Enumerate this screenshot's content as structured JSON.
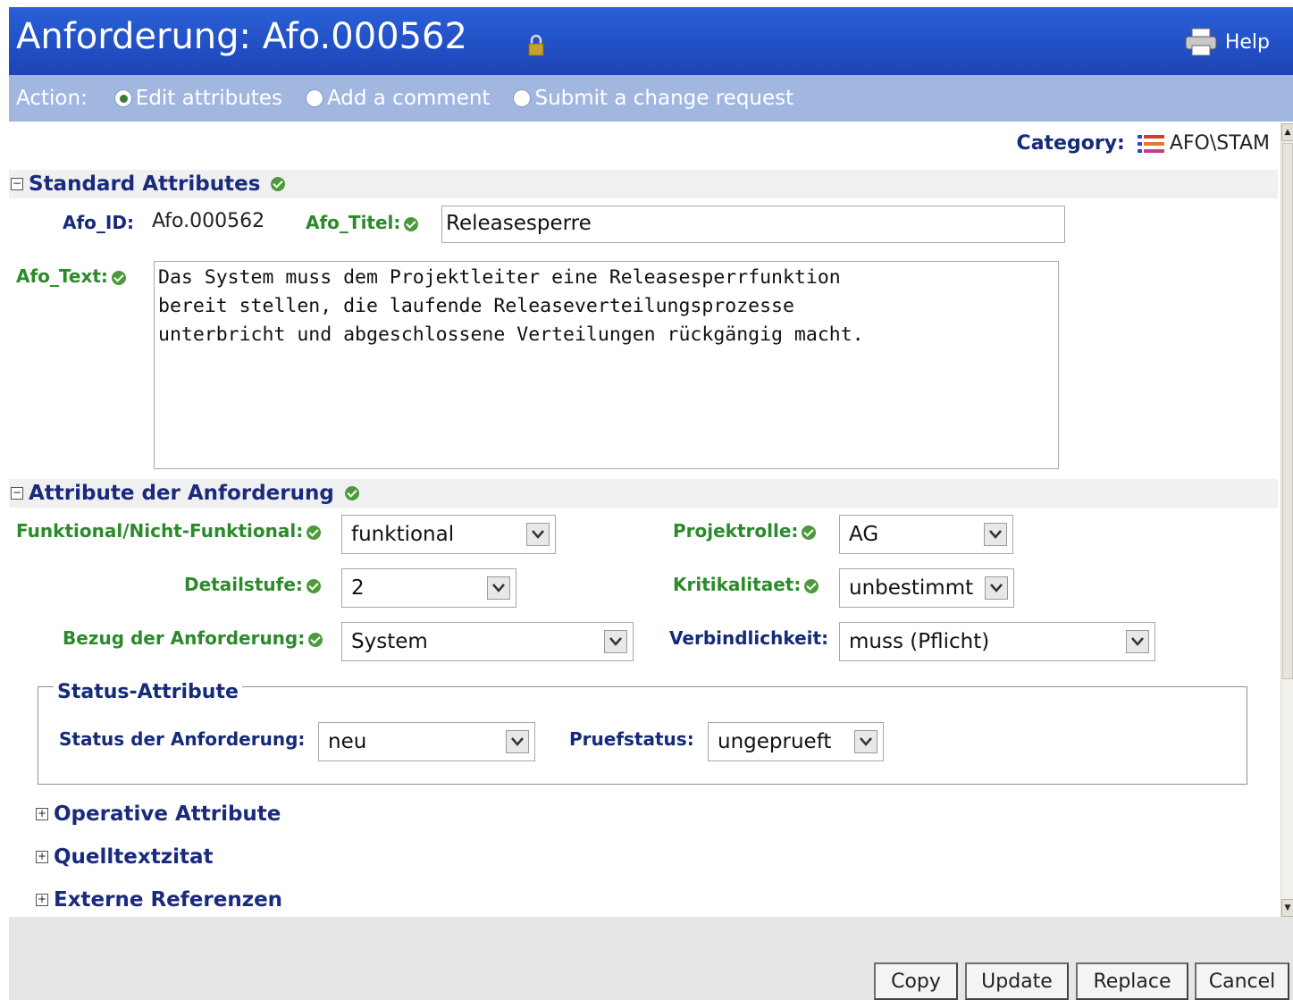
{
  "header": {
    "title": "Anforderung: Afo.000562",
    "help_label": "Help"
  },
  "actionbar": {
    "label": "Action:",
    "options": [
      {
        "label": "Edit attributes",
        "selected": true
      },
      {
        "label": "Add a comment",
        "selected": false
      },
      {
        "label": "Submit a change request",
        "selected": false
      }
    ]
  },
  "category": {
    "label": "Category:",
    "value": "AFO\\STAM"
  },
  "standard": {
    "heading": "Standard Attributes",
    "afo_id_label": "Afo_ID:",
    "afo_id_value": "Afo.000562",
    "afo_titel_label": "Afo_Titel:",
    "afo_titel_value": "Releasesperre",
    "afo_text_label": "Afo_Text:",
    "afo_text_value": "Das System muss dem Projektleiter eine Releasesperrfunktion\nbereit stellen, die laufende Releaseverteilungsprozesse\nunterbricht und abgeschlossene Verteilungen rückgängig macht."
  },
  "anforderung": {
    "heading": "Attribute der Anforderung",
    "funktional_label": "Funktional/Nicht-Funktional:",
    "funktional_value": "funktional",
    "projektrolle_label": "Projektrolle:",
    "projektrolle_value": "AG",
    "detailstufe_label": "Detailstufe:",
    "detailstufe_value": "2",
    "kritikalitaet_label": "Kritikalitaet:",
    "kritikalitaet_value": "unbestimmt",
    "bezug_label": "Bezug der Anforderung:",
    "bezug_value": "System",
    "verbindlichkeit_label": "Verbindlichkeit:",
    "verbindlichkeit_value": "muss (Pflicht)"
  },
  "status": {
    "legend": "Status-Attribute",
    "status_label": "Status der Anforderung:",
    "status_value": "neu",
    "pruef_label": "Pruefstatus:",
    "pruef_value": "ungeprueft"
  },
  "collapsed_sections": {
    "operative": "Operative Attribute",
    "quelltext": "Quelltextzitat",
    "externe": "Externe Referenzen"
  },
  "buttons": {
    "copy": "Copy",
    "update": "Update",
    "replace": "Replace",
    "cancel": "Cancel"
  },
  "colors": {
    "title_bar": "#2a5fd8",
    "action_bar": "#a2b7e0",
    "label_green": "#2b8a2b",
    "label_blue": "#162a7a"
  }
}
